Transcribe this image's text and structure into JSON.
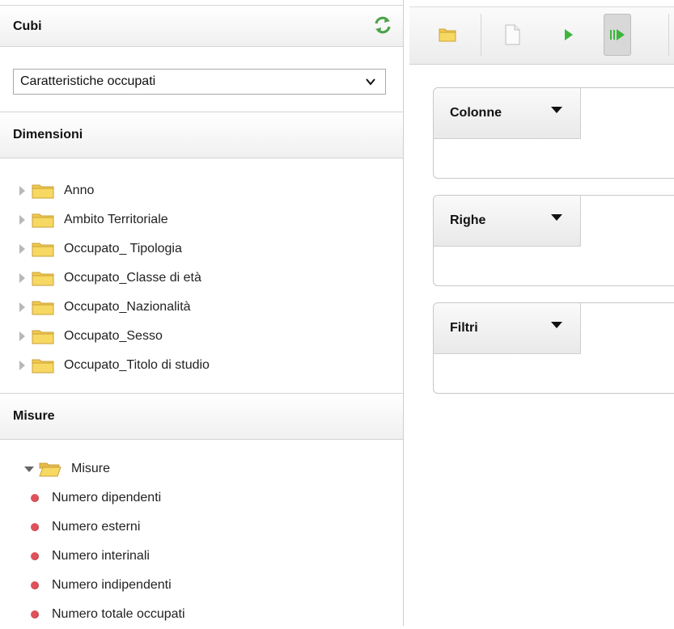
{
  "cubes": {
    "title": "Cubi",
    "refresh_icon": "refresh-icon",
    "selected_cube": "Caratteristiche occupati"
  },
  "dimensions": {
    "title": "Dimensioni",
    "items": [
      {
        "label": "Anno"
      },
      {
        "label": "Ambito Territoriale"
      },
      {
        "label": "Occupato_ Tipologia"
      },
      {
        "label": "Occupato_Classe di età"
      },
      {
        "label": "Occupato_Nazionalità"
      },
      {
        "label": "Occupato_Sesso"
      },
      {
        "label": "Occupato_Titolo di studio"
      }
    ]
  },
  "measures": {
    "title": "Misure",
    "folder_label": "Misure",
    "items": [
      {
        "label": "Numero dipendenti"
      },
      {
        "label": "Numero esterni"
      },
      {
        "label": "Numero interinali"
      },
      {
        "label": "Numero indipendenti"
      },
      {
        "label": "Numero totale occupati"
      }
    ]
  },
  "toolbar": {
    "buttons": [
      "open-folder-icon",
      "new-document-icon",
      "run-icon",
      "run-automatic-icon"
    ]
  },
  "drop_zones": {
    "columns": "Colonne",
    "rows": "Righe",
    "filters": "Filtri"
  },
  "colors": {
    "measure_dot": "#e0525a",
    "folder": "#f2c94c",
    "run_green": "#3db53d"
  }
}
